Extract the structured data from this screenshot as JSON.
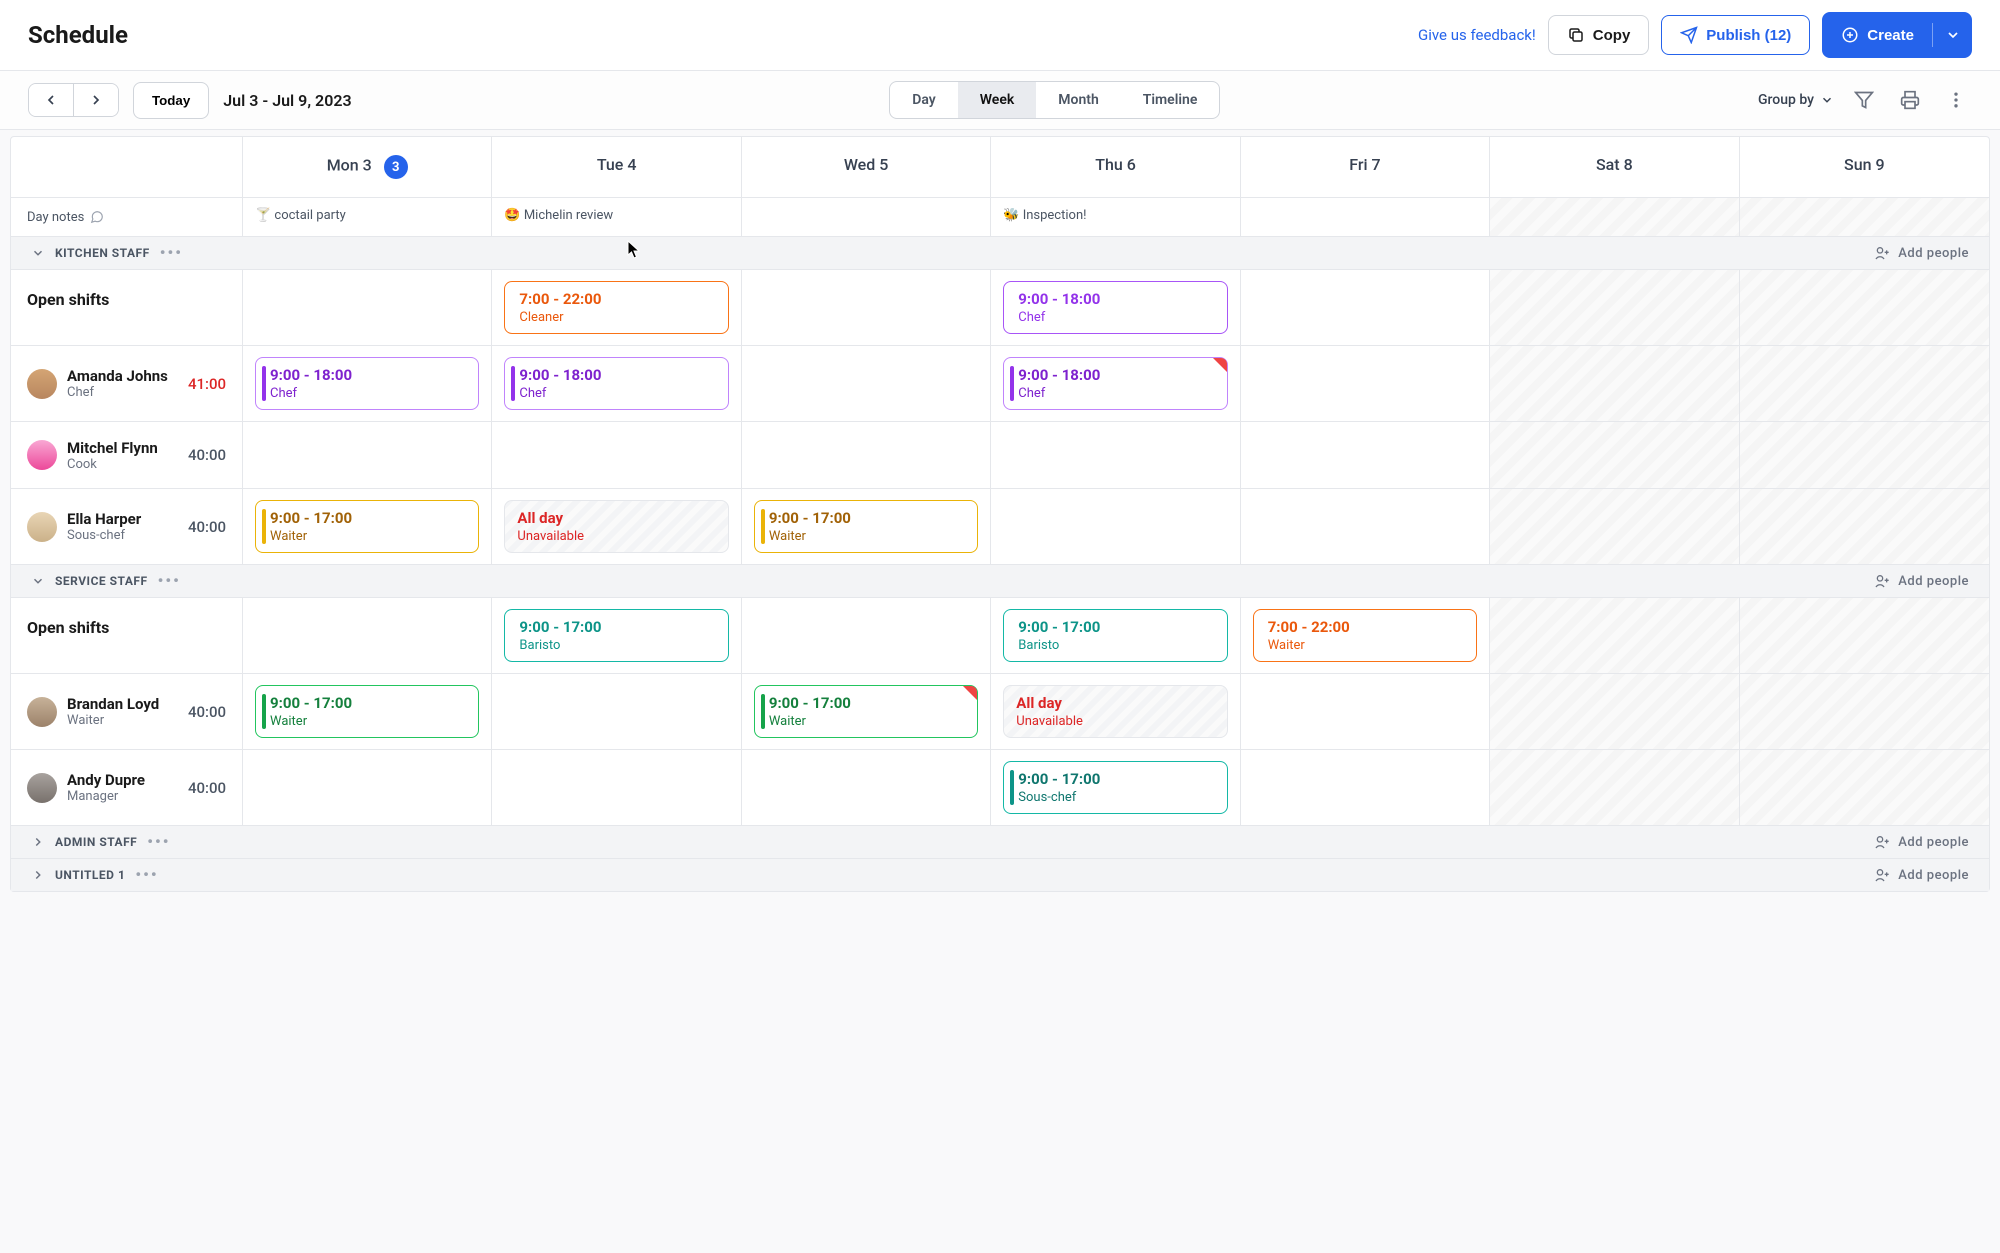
{
  "header": {
    "title": "Schedule",
    "feedback": "Give us feedback!",
    "copy": "Copy",
    "publish": "Publish (12)",
    "create": "Create"
  },
  "toolbar": {
    "today": "Today",
    "range": "Jul 3 - Jul 9, 2023",
    "views": {
      "day": "Day",
      "week": "Week",
      "month": "Month",
      "timeline": "Timeline"
    },
    "groupby": "Group by"
  },
  "days": [
    {
      "label": "Mon 3",
      "badge": "3"
    },
    {
      "label": "Tue 4"
    },
    {
      "label": "Wed 5"
    },
    {
      "label": "Thu 6"
    },
    {
      "label": "Fri 7"
    },
    {
      "label": "Sat 8"
    },
    {
      "label": "Sun 9"
    }
  ],
  "notes": {
    "label": "Day notes",
    "items": [
      "🍸 coctail party",
      "🤩 Michelin review",
      "",
      "🐝 Inspection!",
      "",
      "",
      ""
    ]
  },
  "groups": {
    "kitchen": {
      "name": "KITCHEN STAFF",
      "add": "Add people"
    },
    "service": {
      "name": "SERVICE STAFF",
      "add": "Add people"
    },
    "admin": {
      "name": "ADMIN STAFF",
      "add": "Add people"
    },
    "untitled": {
      "name": "UNTITLED 1",
      "add": "Add people"
    }
  },
  "labels": {
    "open_shifts": "Open shifts"
  },
  "staff": {
    "amanda": {
      "name": "Amanda Johns",
      "role": "Chef",
      "hours": "41:00"
    },
    "mitchel": {
      "name": "Mitchel Flynn",
      "role": "Cook",
      "hours": "40:00"
    },
    "ella": {
      "name": "Ella Harper",
      "role": "Sous-chef",
      "hours": "40:00"
    },
    "brandan": {
      "name": "Brandan Loyd",
      "role": "Waiter",
      "hours": "40:00"
    },
    "andy": {
      "name": "Andy Dupre",
      "role": "Manager",
      "hours": "40:00"
    }
  },
  "shifts": {
    "k_open_tue": {
      "time": "7:00 - 22:00",
      "role": "Cleaner"
    },
    "k_open_thu": {
      "time": "9:00 - 18:00",
      "role": "Chef"
    },
    "amanda_mon": {
      "time": "9:00 - 18:00",
      "role": "Chef"
    },
    "amanda_tue": {
      "time": "9:00 - 18:00",
      "role": "Chef"
    },
    "amanda_thu": {
      "time": "9:00 - 18:00",
      "role": "Chef"
    },
    "ella_mon": {
      "time": "9:00 - 17:00",
      "role": "Waiter"
    },
    "ella_tue": {
      "time": "All day",
      "role": "Unavailable"
    },
    "ella_wed": {
      "time": "9:00 - 17:00",
      "role": "Waiter"
    },
    "s_open_tue": {
      "time": "9:00 - 17:00",
      "role": "Baristo"
    },
    "s_open_thu": {
      "time": "9:00 - 17:00",
      "role": "Baristo"
    },
    "s_open_fri": {
      "time": "7:00 - 22:00",
      "role": "Waiter"
    },
    "brandan_mon": {
      "time": "9:00 - 17:00",
      "role": "Waiter"
    },
    "brandan_wed": {
      "time": "9:00 - 17:00",
      "role": "Waiter"
    },
    "brandan_thu": {
      "time": "All day",
      "role": "Unavailable"
    },
    "andy_thu": {
      "time": "9:00 - 17:00",
      "role": "Sous-chef"
    }
  }
}
